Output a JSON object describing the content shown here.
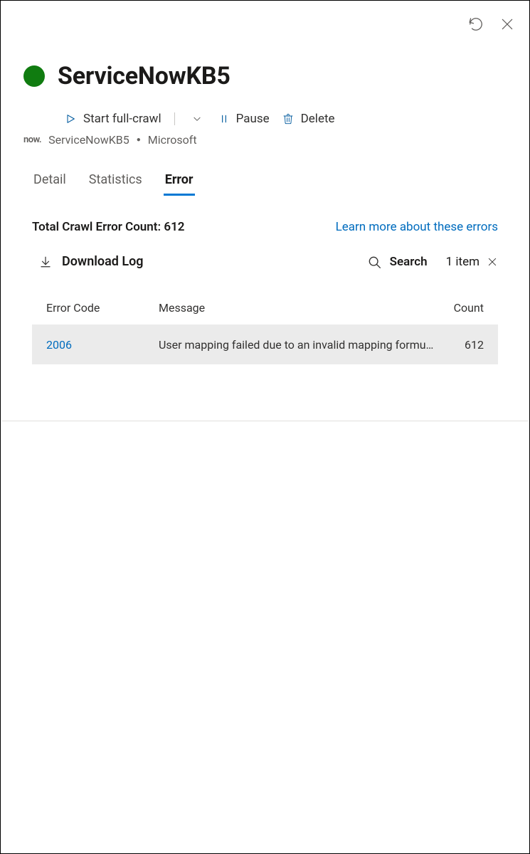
{
  "header": {
    "title": "ServiceNowKB5",
    "status_color": "#107c10"
  },
  "commands": {
    "start_label": "Start full-crawl",
    "pause_label": "Pause",
    "delete_label": "Delete"
  },
  "breadcrumb": {
    "logo_text": "now.",
    "item1": "ServiceNowKB5",
    "item2": "Microsoft"
  },
  "tabs": {
    "detail": "Detail",
    "statistics": "Statistics",
    "error": "Error",
    "selected": "error"
  },
  "summary": {
    "total_label": "Total Crawl Error Count: 612",
    "learn_more": "Learn more about these errors"
  },
  "toolbar": {
    "download_label": "Download Log",
    "search_label": "Search",
    "item_count_label": "1 item"
  },
  "table": {
    "headers": {
      "code": "Error Code",
      "message": "Message",
      "count": "Count"
    },
    "rows": [
      {
        "code": "2006",
        "message": "User mapping failed due to an invalid mapping formula or no A…",
        "count": "612"
      }
    ]
  }
}
